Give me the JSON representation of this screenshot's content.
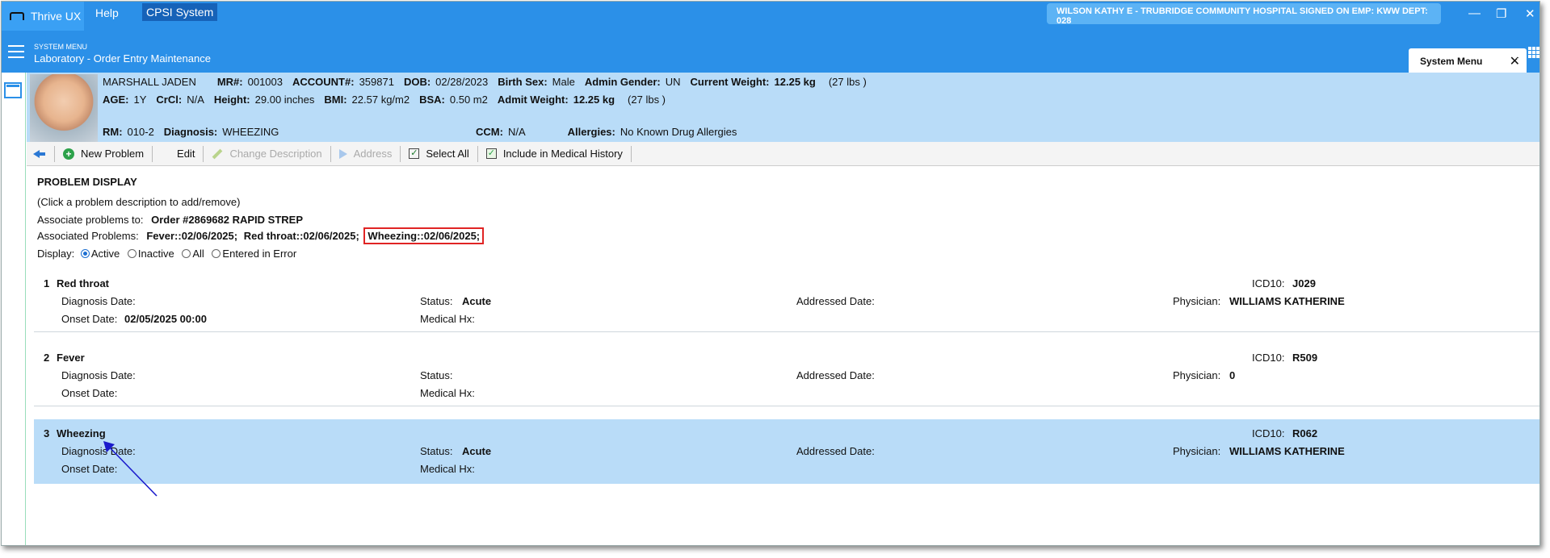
{
  "window": {
    "app_tab": "Thrive UX",
    "help": "Help",
    "system_tab": "CPSI System",
    "user_info": "WILSON KATHY E - TRUBRIDGE COMMUNITY HOSPITAL   SIGNED ON EMP: KWW  DEPT: 028"
  },
  "header": {
    "menu_label": "SYSTEM MENU",
    "title": "Laboratory - Order Entry Maintenance",
    "system_menu_tab": "System Menu"
  },
  "patient": {
    "name": "MARSHALL JADEN",
    "mr_label": "MR#:",
    "mr": "001003",
    "account_label": "ACCOUNT#:",
    "account": "359871",
    "dob_label": "DOB:",
    "dob": "02/28/2023",
    "birth_sex_label": "Birth Sex:",
    "birth_sex": "Male",
    "admit_gender_label": "Admin Gender:",
    "admit_gender": "UN",
    "current_weight_label": "Current Weight:",
    "current_weight": "12.25 kg",
    "current_weight_lbs": "(27 lbs )",
    "age_label": "AGE:",
    "age": "1Y",
    "crcl_label": "CrCl:",
    "crcl": "N/A",
    "height_label": "Height:",
    "height": "29.00 inches",
    "bmi_label": "BMI:",
    "bmi": "22.57 kg/m2",
    "bsa_label": "BSA:",
    "bsa": "0.50 m2",
    "admit_weight_label": "Admit Weight:",
    "admit_weight": "12.25 kg",
    "admit_weight_lbs": "(27 lbs )",
    "rm_label": "RM:",
    "rm": "010-2",
    "diagnosis_label": "Diagnosis:",
    "diagnosis": "WHEEZING",
    "ccm_label": "CCM:",
    "ccm": "N/A",
    "allergies_label": "Allergies:",
    "allergies": "No Known Drug Allergies"
  },
  "toolbar": {
    "new_problem": "New Problem",
    "edit": "Edit",
    "change_description": "Change Description",
    "address": "Address",
    "select_all": "Select All",
    "include_medical_history": "Include in Medical History"
  },
  "problem_display": {
    "heading": "PROBLEM DISPLAY",
    "hint": "(Click a problem description to add/remove)",
    "associate_label": "Associate problems to:",
    "associate_value": "Order #2869682 RAPID STREP",
    "associated_label": "Associated Problems:",
    "associated_items": [
      "Fever::02/06/2025;",
      "Red throat::02/06/2025;",
      "Wheezing::02/06/2025;"
    ],
    "display_label": "Display:",
    "display_options": [
      "Active",
      "Inactive",
      "All",
      "Entered in Error"
    ],
    "display_selected": "Active"
  },
  "field_labels": {
    "diagnosis_date": "Diagnosis Date:",
    "onset_date": "Onset Date:",
    "status": "Status:",
    "medical_hx": "Medical Hx:",
    "addressed_date": "Addressed Date:",
    "icd10": "ICD10:",
    "physician": "Physician:"
  },
  "problems": [
    {
      "num": "1",
      "name": "Red throat",
      "status": "Acute",
      "onset_date": "02/05/2025 00:00",
      "icd10": "J029",
      "physician": "WILLIAMS KATHERINE",
      "selected": false
    },
    {
      "num": "2",
      "name": "Fever",
      "status": "",
      "onset_date": "",
      "icd10": "R509",
      "physician": "0",
      "selected": false
    },
    {
      "num": "3",
      "name": "Wheezing",
      "status": "Acute",
      "onset_date": "",
      "icd10": "R062",
      "physician": "WILLIAMS KATHERINE",
      "selected": true
    }
  ],
  "colors": {
    "title_bar": "#2b90e8",
    "patient_banner": "#b9dcf8",
    "selected_row": "#b9dcf8",
    "highlight_box": "#e02424",
    "annotation_arrow": "#1a1acc"
  }
}
